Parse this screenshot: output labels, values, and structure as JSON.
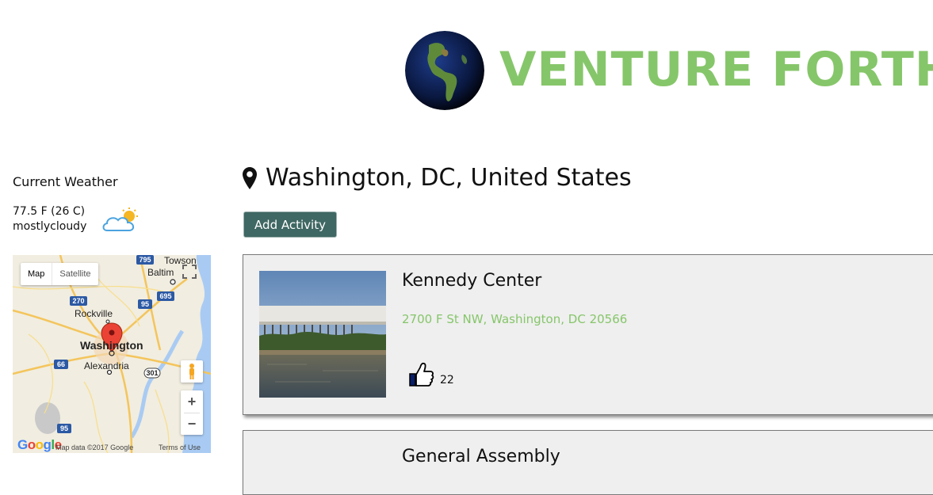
{
  "brand": {
    "title": "VENTURE FORTH",
    "color": "#86c66a"
  },
  "sidebar": {
    "weather_title": "Current Weather",
    "temperature": "77.5 F (26 C)",
    "condition": "mostlycloudy",
    "weather_icon": "partly-cloudy-icon",
    "map": {
      "toggle_map": "Map",
      "toggle_satellite": "Satellite",
      "labels": [
        "Towson",
        "Baltim",
        "Rockville",
        "Washington",
        "Alexandria"
      ],
      "highways": [
        "795",
        "270",
        "95",
        "695",
        "66",
        "301",
        "95"
      ],
      "google": "Google",
      "attribution": "Map data ©2017 Google",
      "terms": "Terms of Use"
    }
  },
  "main": {
    "location": "Washington, DC, United States",
    "add_activity": "Add Activity",
    "activities": [
      {
        "name": "Kennedy Center",
        "address": "2700 F St NW, Washington, DC 20566",
        "likes": "22"
      },
      {
        "name": "General Assembly"
      }
    ]
  },
  "colors": {
    "button": "#3f6763",
    "address": "#86c66a",
    "card": "#efefef"
  }
}
